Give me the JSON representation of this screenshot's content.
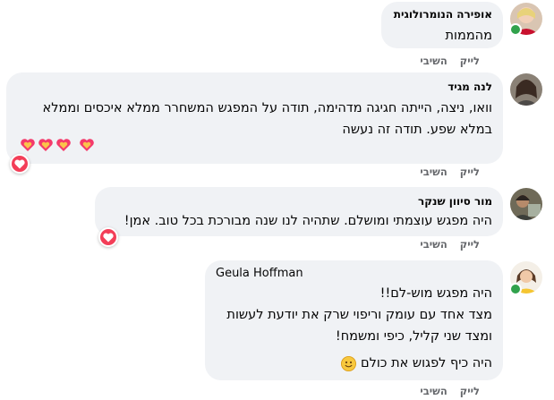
{
  "comments": [
    {
      "author": "אופירה הנומרולוגית",
      "lines": [
        "מהממות"
      ],
      "actions": {
        "like": "לייק",
        "reply": "השיבי"
      }
    },
    {
      "author": "לנה מגיד",
      "lines": [
        "וואו, ניצה, הייתה חגיגה מדהימה, תודה על המפגש המשחרר ממלא איכסים וממלא",
        "במלא שפע. תודה זה נעשה"
      ],
      "reaction": "heart",
      "actions": {
        "like": "לייק",
        "reply": "השיבי"
      }
    },
    {
      "author": "מור סיוון שנקר",
      "lines": [
        "היה מפגש עוצמתי ומושלם. שתהיה לנו שנה מבורכת בכל טוב. אמן!"
      ],
      "reaction": "heart",
      "actions": {
        "like": "לייק",
        "reply": "השיבי"
      }
    },
    {
      "author": "Geula Hoffman",
      "lines": [
        "היה מפגש מוש-לם!!",
        "מצד אחד עם עומק וריפוי שרק את יודעת לעשות",
        "ומצד שני קליל, כיפי ומשמח!",
        "",
        "היה כיף לפגוש את כולם"
      ],
      "actions": {
        "like": "לייק",
        "reply": "השיבי"
      }
    }
  ],
  "colors": {
    "bubble": "#f0f2f5",
    "online": "#31a24c",
    "action_text": "#65676b",
    "heart_reaction": "#f33e58"
  },
  "icons": {
    "reaction": "heart-icon",
    "sparkling_heart": "sparkling-heart-emoji",
    "smile": "smiling-face-emoji"
  }
}
